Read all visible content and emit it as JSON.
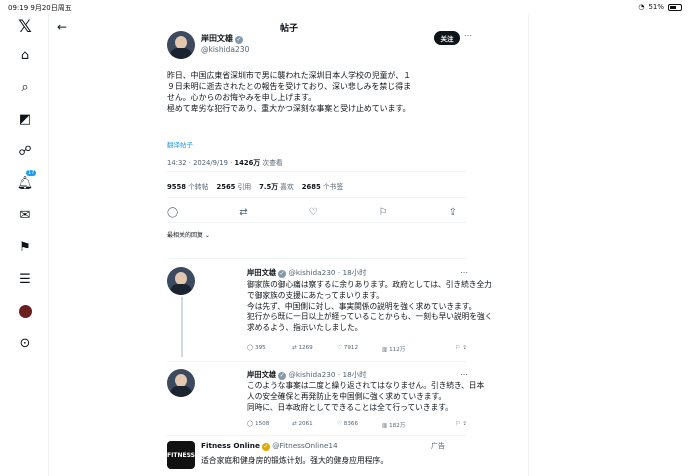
{
  "status_bar": {
    "time_date": "09:19  9月20日周五",
    "battery": "51%"
  },
  "sidebar": {
    "notification_count": "17"
  },
  "header": {
    "title": "帖子"
  },
  "post": {
    "name": "岸田文雄",
    "handle": "@kishida230",
    "follow_label": "关注",
    "text_lines": [
      "昨日、中国広東省深圳市で男に襲われた深圳日本人学校の児童が、１",
      "９日未明に逝去されたとの報告を受けており、深い悲しみを禁じ得ま",
      "せん。心からのお悔やみを申し上げます。",
      "極めて卑劣な犯行であり、重大かつ深刻な事案と受け止めています。"
    ],
    "translate_label": "翻译帖子",
    "time": "14:32 · 2024/9/19 · ",
    "views": "1426万",
    "views_label": " 次查看",
    "stats": {
      "reposts": "9558",
      "reposts_label": " 个转帖",
      "quotes": "2565",
      "quotes_label": " 引用",
      "likes": "7.5万",
      "likes_label": " 喜欢",
      "bookmarks": "2685",
      "bookmarks_label": " 个书签"
    },
    "reply_filter": "最相关的回复 ⌄"
  },
  "replies": [
    {
      "name": "岸田文雄",
      "handle": "@kishida230 · 18小时",
      "lines": [
        "御家族の御心痛は察するに余りあります。政府としては、引き続き全力",
        "で御家族の支援にあたってまいります。",
        "今は先ず、中国側に対し、事実関係の説明を強く求めていきます。",
        "犯行から既に一日以上が経っていることからも、一刻も早い説明を強く",
        "求めるよう、指示いたしました。"
      ],
      "replies": "395",
      "reposts": "1269",
      "likes": "7912",
      "views": "112万"
    },
    {
      "name": "岸田文雄",
      "handle": "@kishida230 · 18小时",
      "lines": [
        "このような事案は二度と繰り返されてはなりません。引き続き、日本",
        "人の安全確保と再発防止を中国側に強く求めていきます。",
        "同時に、日本政府としてできることは全て行っていきます。"
      ],
      "replies": "1508",
      "reposts": "2061",
      "likes": "8366",
      "views": "182万"
    }
  ],
  "ad": {
    "name": "Fitness Online",
    "handle": "@FitnessOnline14",
    "label": "广告",
    "text": "适合家庭和健身房的锻炼计划。强大的健身应用程序。",
    "avatar_text": "FITNESS"
  }
}
